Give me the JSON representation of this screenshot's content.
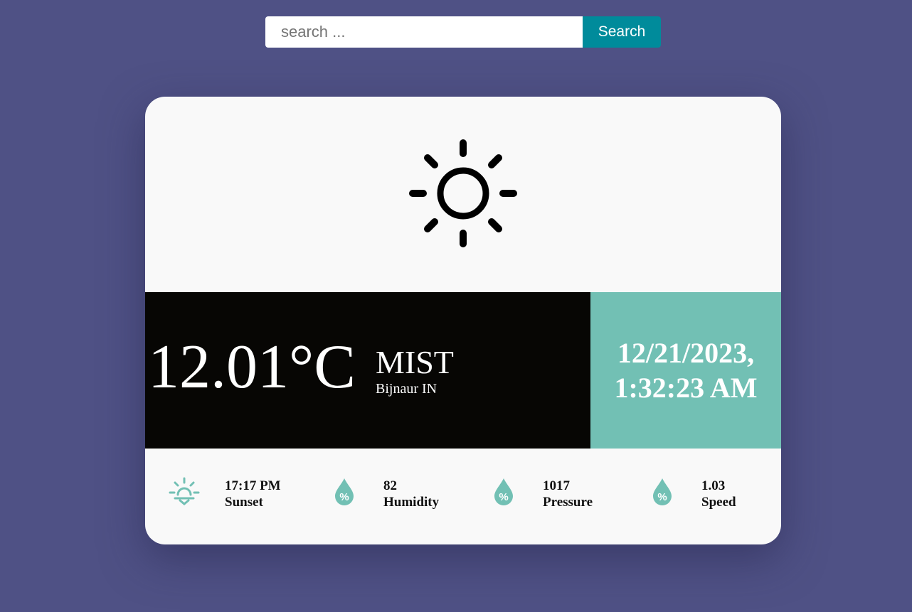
{
  "search": {
    "placeholder": "search ...",
    "value": "",
    "button_label": "Search"
  },
  "weather": {
    "icon": "sun-icon",
    "temperature": "12.01°C",
    "condition": "MIST",
    "location": "Bijnaur IN",
    "date": "12/21/2023,",
    "time": "1:32:23 AM"
  },
  "stats": [
    {
      "icon": "sunset-icon",
      "value": "17:17 PM",
      "label": "Sunset"
    },
    {
      "icon": "humidity-drop-icon",
      "value": "82",
      "label": "Humidity"
    },
    {
      "icon": "pressure-drop-icon",
      "value": "1017",
      "label": "Pressure"
    },
    {
      "icon": "speed-drop-icon",
      "value": "1.03",
      "label": "Speed"
    }
  ],
  "colors": {
    "background": "#4f5185",
    "accent": "#72c0b4",
    "search_button": "#008b9b",
    "temp_panel": "#070604",
    "card": "#f9f9f9"
  }
}
